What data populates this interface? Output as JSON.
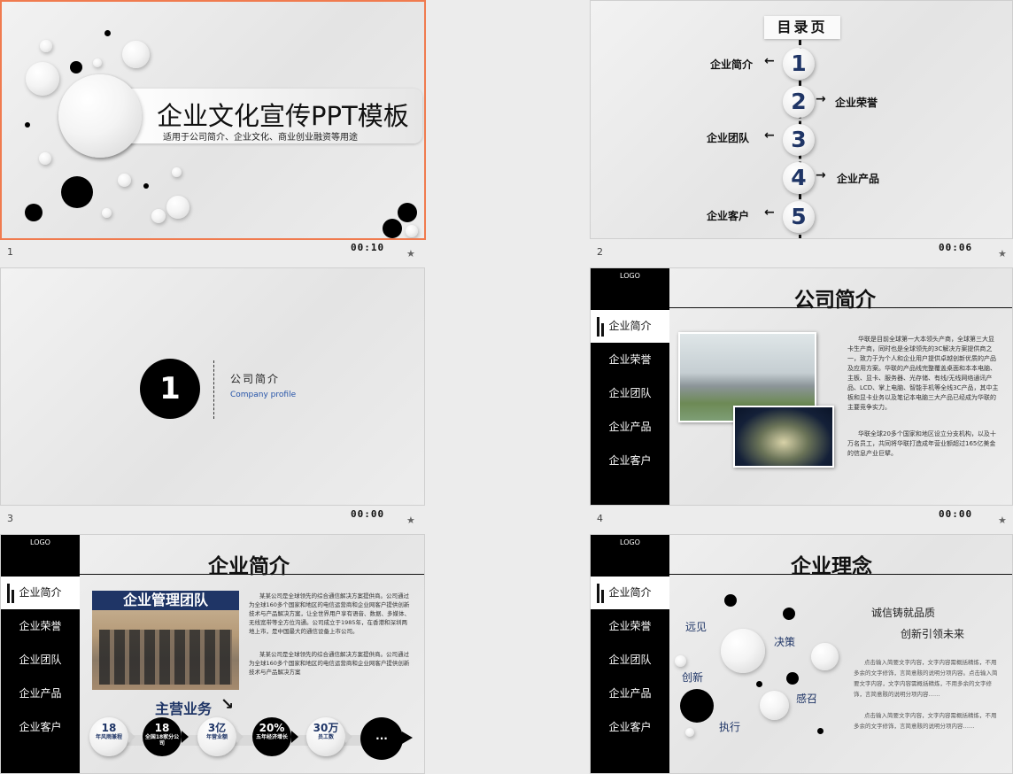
{
  "slides": [
    {
      "number": "1",
      "time": "00:10"
    },
    {
      "number": "2",
      "time": "00:06"
    },
    {
      "number": "3",
      "time": "00:00"
    },
    {
      "number": "4",
      "time": "00:00"
    },
    {
      "number": "5",
      "time": "00:00"
    },
    {
      "number": "6",
      "time": "00:00"
    }
  ],
  "star_glyph": "★",
  "slide1": {
    "title": "企业文化宣传PPT模板",
    "subtitle": "适用于公司简介、企业文化、商业创业融资等用途"
  },
  "slide2": {
    "header": "目录页",
    "items": [
      {
        "num": "1",
        "label": "企业简介"
      },
      {
        "num": "2",
        "label": "企业荣誉"
      },
      {
        "num": "3",
        "label": "企业团队"
      },
      {
        "num": "4",
        "label": "企业产品"
      },
      {
        "num": "5",
        "label": "企业客户"
      }
    ]
  },
  "slide3": {
    "num": "1",
    "title": "公司简介",
    "subtitle": "Company profile"
  },
  "logo": {
    "glyph": "",
    "text": "LOGO"
  },
  "sidebar4": [
    "企业简介",
    "企业荣誉",
    "企业团队",
    "企业产品",
    "企业客户"
  ],
  "slide4": {
    "title": "公司简介",
    "p1": "华联是目前全球第一大本领头产商，全球第三大显卡生产商，同时也是全球领先的3C解决方案提供商之一，致力于为个人和企业用户提供卓越创新优质的产品及应用方案。华联的产品线完整覆盖桌面和本本电脑、主板、显卡、服务器、光存储、有线/无线网络通讯产品、LCD、掌上电脑、智能手机等全线3C产品，其中主板和显卡业务以及笔记本电脑三大产品已经成为华联的主要竞争实力。",
    "p2": "华联全球20多个国家和地区设立分支机构，以及十万名员工，共同将华联打造成年营业额超过165亿美金的信息产业巨擘。"
  },
  "slide5": {
    "title": "企业简介",
    "team_banner": "企业管理团队",
    "p1": "某某公司是全球领先的综合通信解决方案提供商。公司通过为全球160多个国家和地区的电信运营商和企业网客户提供创新技术与产品解决方案，让全世界用户享有语音、数据、多媒体、无线宽带等全方位沟通。公司成立于1985年，在香港和深圳两地上市，是中国最大的通信设备上市公司。",
    "p2": "某某公司是全球领先的综合通信解决方案提供商。公司通过为全球160多个国家和地区的电信运营商和企业网客户提供创新技术与产品解决方案",
    "business": "主营业务",
    "stats": [
      {
        "n": "18",
        "t": "年风雨兼程"
      },
      {
        "n": "18",
        "t": "全国18家分公司"
      },
      {
        "n": "3亿",
        "t": "年营业额"
      },
      {
        "n": "20%",
        "t": "五年经济增长"
      },
      {
        "n": "30万",
        "t": "员工数"
      },
      {
        "n": "...",
        "t": ""
      }
    ]
  },
  "slide6": {
    "title": "企业理念",
    "tag1": "诚信铸就品质",
    "tag2": "创新引领未来",
    "words": {
      "yuanjian": "远见",
      "juece": "决策",
      "chuangxin": "创新",
      "ganzhao": "感召",
      "zhixing": "执行"
    },
    "p1": "点击输入简要文字内容，文字内容需概括精炼，不用多余的文字修饰，言简意赅的说明分项内容。点击输入简要文字内容，文字内容需概括精炼，不用多余的文字修饰，言简意赅的说明分项内容……",
    "p2": "点击输入简要文字内容，文字内容需概括精炼，不用多余的文字修饰，言简意赅的说明分项内容……"
  }
}
